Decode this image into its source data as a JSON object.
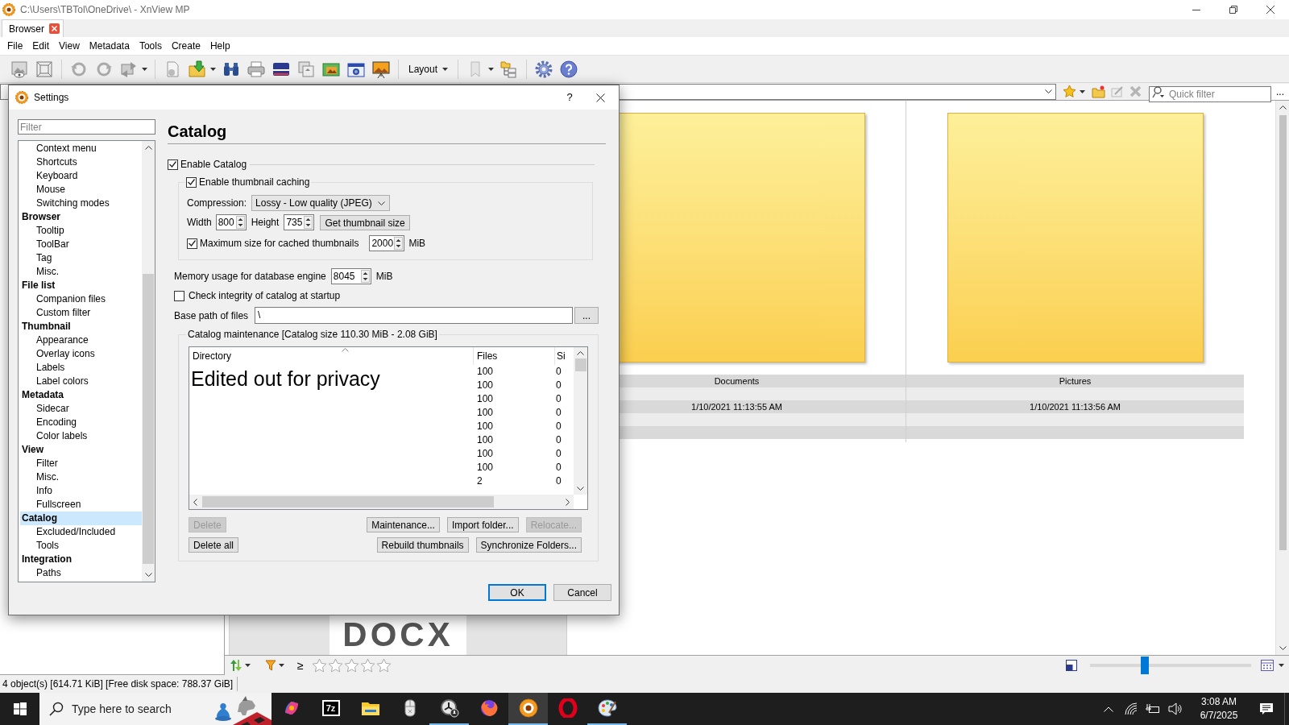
{
  "window": {
    "title": "C:\\Users\\TBTol\\OneDrive\\ - XnView MP"
  },
  "tabs": [
    {
      "label": "Browser",
      "selected": true
    }
  ],
  "menu": [
    "File",
    "Edit",
    "View",
    "Metadata",
    "Tools",
    "Create",
    "Help"
  ],
  "toolbar": {
    "layout_label": "Layout"
  },
  "address_bar": {
    "quick_filter_placeholder": "Quick filter",
    "more": "..."
  },
  "thumbnails": [
    {
      "kind": "folder",
      "name": "Documents",
      "date": "1/10/2021 11:13:55 AM"
    },
    {
      "kind": "folder",
      "name": "Pictures",
      "date": "1/10/2021 11:13:56 AM"
    },
    {
      "kind": "document",
      "label": "DOCX"
    }
  ],
  "filter_bar": {
    "operator": "≥",
    "stars": 0
  },
  "zoom_slider": {
    "level": 0.33
  },
  "status_bar": "4 object(s) [614.71 KiB] [Free disk space: 788.37 GiB]",
  "dialog": {
    "title": "Settings",
    "help": "?",
    "filter_placeholder": "Filter",
    "tree": [
      {
        "children": [
          {
            "label": "Context menu",
            "selected": false
          },
          {
            "label": "Shortcuts",
            "selected": false
          },
          {
            "label": "Keyboard",
            "selected": false
          },
          {
            "label": "Mouse",
            "selected": false
          },
          {
            "label": "Switching modes",
            "selected": false
          }
        ]
      },
      {
        "label": "Browser",
        "selected": false,
        "children": [
          {
            "label": "Tooltip",
            "selected": false
          },
          {
            "label": "ToolBar",
            "selected": false
          },
          {
            "label": "Tag",
            "selected": false
          },
          {
            "label": "Misc.",
            "selected": false
          }
        ]
      },
      {
        "label": "File list",
        "selected": false,
        "children": [
          {
            "label": "Companion files",
            "selected": false
          },
          {
            "label": "Custom filter",
            "selected": false
          }
        ]
      },
      {
        "label": "Thumbnail",
        "selected": false,
        "children": [
          {
            "label": "Appearance",
            "selected": false
          },
          {
            "label": "Overlay icons",
            "selected": false
          },
          {
            "label": "Labels",
            "selected": false
          },
          {
            "label": "Label colors",
            "selected": false
          }
        ]
      },
      {
        "label": "Metadata",
        "selected": false,
        "children": [
          {
            "label": "Sidecar",
            "selected": false
          },
          {
            "label": "Encoding",
            "selected": false
          },
          {
            "label": "Color labels",
            "selected": false
          }
        ]
      },
      {
        "label": "View",
        "selected": false,
        "children": [
          {
            "label": "Filter",
            "selected": false
          },
          {
            "label": "Misc.",
            "selected": false
          },
          {
            "label": "Info",
            "selected": false
          },
          {
            "label": "Fullscreen",
            "selected": false
          }
        ]
      },
      {
        "label": "Catalog",
        "selected": true,
        "children": [
          {
            "label": "Excluded/Included",
            "selected": false
          },
          {
            "label": "Tools",
            "selected": false
          }
        ]
      },
      {
        "label": "Integration",
        "selected": false,
        "children": [
          {
            "label": "Paths",
            "selected": false
          }
        ]
      }
    ],
    "heading": "Catalog",
    "enable_catalog": {
      "label": "Enable Catalog",
      "checked": true
    },
    "thumbnail_caching": {
      "label": "Enable thumbnail caching",
      "checked": true
    },
    "compression": {
      "label": "Compression:",
      "value": "Lossy - Low quality (JPEG)"
    },
    "width": {
      "label": "Width",
      "value": "800"
    },
    "height": {
      "label": "Height",
      "value": "735"
    },
    "get_size_button": "Get thumbnail size",
    "max_size": {
      "label": "Maximum size for cached thumbnails",
      "checked": true,
      "value": "2000",
      "unit": "MiB"
    },
    "memory": {
      "label": "Memory usage for database engine",
      "value": "8045",
      "unit": "MiB"
    },
    "check_integrity": {
      "label": "Check integrity of catalog at startup",
      "checked": false
    },
    "base_path": {
      "label": "Base path of files",
      "value": "\\",
      "browse": "..."
    },
    "maintenance": {
      "title": "Catalog maintenance [Catalog size 110.30 MiB - 2.08 GiB]",
      "columns": [
        "Directory",
        "Files",
        "Si"
      ],
      "privacy_note": "Edited out for privacy",
      "rows": [
        {
          "files": "100",
          "size": "0"
        },
        {
          "files": "100",
          "size": "0"
        },
        {
          "files": "100",
          "size": "0"
        },
        {
          "files": "100",
          "size": "0"
        },
        {
          "files": "100",
          "size": "0"
        },
        {
          "files": "100",
          "size": "0"
        },
        {
          "files": "100",
          "size": "0"
        },
        {
          "files": "100",
          "size": "0"
        },
        {
          "files": "2",
          "size": "0"
        }
      ],
      "buttons_top": [
        {
          "label": "Delete",
          "disabled": true
        },
        {
          "label": "Maintenance...",
          "disabled": false
        },
        {
          "label": "Import folder...",
          "disabled": false
        },
        {
          "label": "Relocate...",
          "disabled": true
        }
      ],
      "buttons_bottom": [
        {
          "label": "Delete all",
          "disabled": false
        },
        {
          "label": "Rebuild thumbnails",
          "disabled": false
        },
        {
          "label": "Synchronize Folders...",
          "disabled": false
        }
      ]
    },
    "ok": "OK",
    "cancel": "Cancel"
  },
  "taskbar": {
    "search_placeholder": "Type here to search",
    "apps": [
      {
        "kind": "swirl",
        "running": false,
        "selected": false
      },
      {
        "kind": "archive",
        "label": "7z",
        "running": false,
        "selected": false
      },
      {
        "kind": "folder",
        "running": false,
        "selected": false
      },
      {
        "kind": "mouse",
        "running": false,
        "selected": false
      },
      {
        "kind": "clock",
        "running": true,
        "selected": false
      },
      {
        "kind": "fox",
        "running": false,
        "selected": false
      },
      {
        "kind": "sun",
        "running": true,
        "selected": true
      },
      {
        "kind": "ring",
        "running": false,
        "selected": false
      },
      {
        "kind": "palette",
        "running": true,
        "selected": false
      }
    ],
    "time": "3:08 AM",
    "date": "6/7/2025"
  }
}
